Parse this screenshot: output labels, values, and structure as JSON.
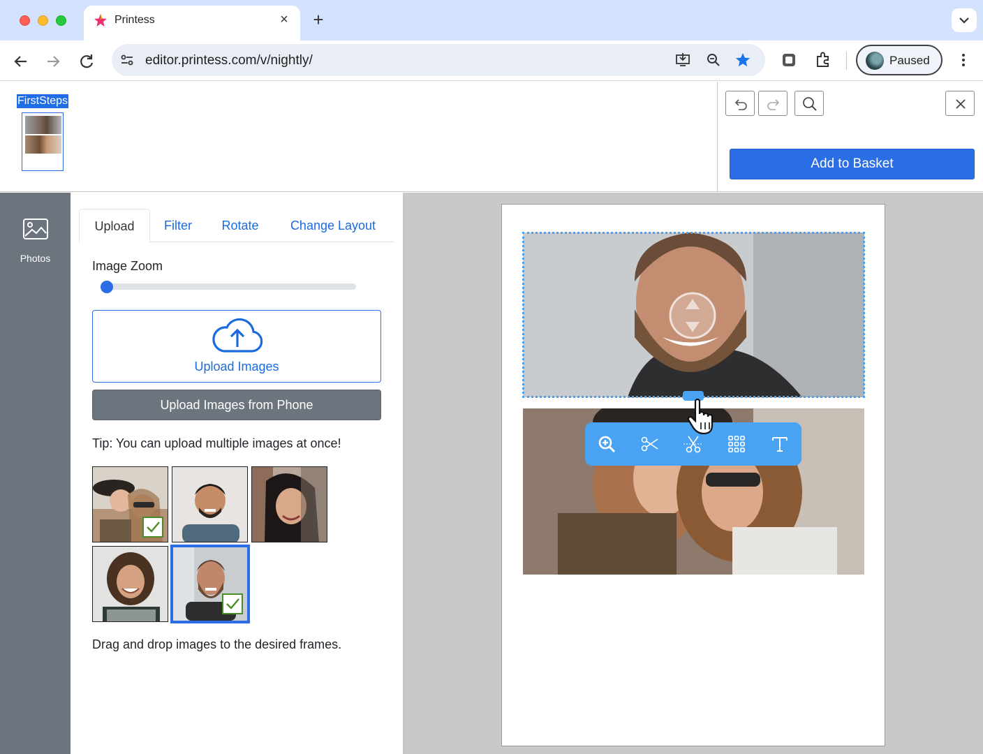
{
  "browser": {
    "tab_title": "Printess",
    "tab_close": "×",
    "new_tab": "+",
    "url": "editor.printess.com/v/nightly/",
    "profile_label": "Paused"
  },
  "app": {
    "page_label": "FirstSteps",
    "add_to_basket": "Add to Basket",
    "sidebar": {
      "photos_label": "Photos"
    },
    "panel": {
      "tabs": [
        "Upload",
        "Filter",
        "Rotate",
        "Change Layout"
      ],
      "image_zoom_label": "Image Zoom",
      "image_zoom_value": 0,
      "upload_images_label": "Upload Images",
      "upload_phone_label": "Upload Images from Phone",
      "tip": "Tip: You can upload multiple images at once!",
      "drag_tip": "Drag and drop images to the desired frames."
    }
  }
}
